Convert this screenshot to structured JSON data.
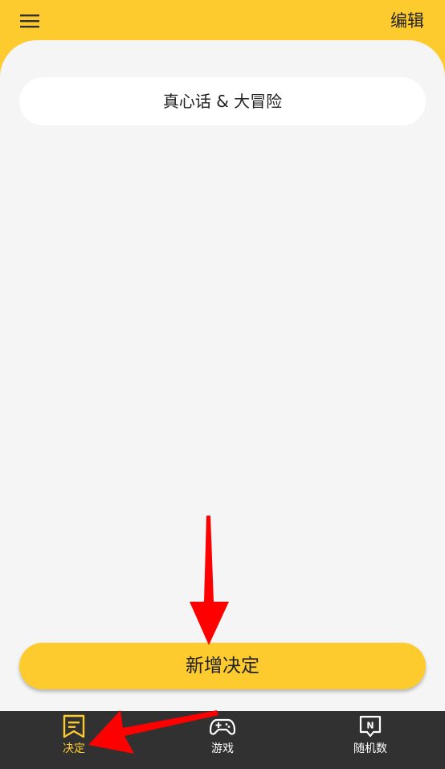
{
  "header": {
    "menu_icon": "hamburger-menu-icon",
    "edit_label": "编辑"
  },
  "decisions": [
    {
      "label": "真心话 & 大冒险"
    }
  ],
  "add_button": {
    "label": "新增决定"
  },
  "bottom_nav": {
    "items": [
      {
        "label": "决定",
        "icon": "bookmark-list-icon",
        "active": true
      },
      {
        "label": "游戏",
        "icon": "gamepad-icon",
        "active": false
      },
      {
        "label": "随机数",
        "icon": "number-bubble-icon",
        "icon_text": "N",
        "active": false
      }
    ]
  },
  "colors": {
    "accent": "#fecb2f",
    "background": "#f5f5f5",
    "nav_background": "#313131",
    "annotation_arrow": "#ff0000"
  }
}
